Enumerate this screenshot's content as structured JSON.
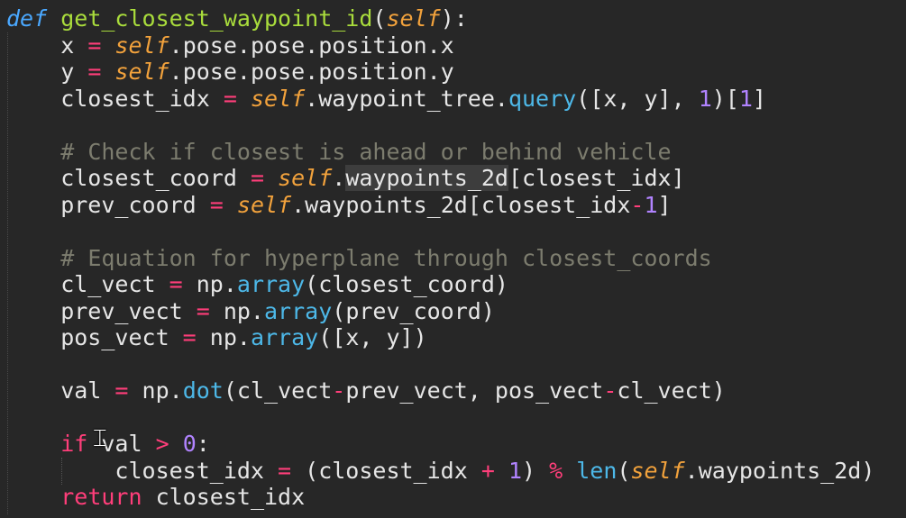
{
  "code_lines": [
    [
      {
        "t": "def",
        "c": "kw-def"
      },
      {
        "t": " "
      },
      {
        "t": "get_closest_waypoint_id",
        "c": "fn"
      },
      {
        "t": "("
      },
      {
        "t": "self",
        "c": "self"
      },
      {
        "t": "):"
      }
    ],
    [
      {
        "t": "    x "
      },
      {
        "t": "=",
        "c": "op"
      },
      {
        "t": " "
      },
      {
        "t": "self",
        "c": "self"
      },
      {
        "t": ".pose.pose.position.x"
      }
    ],
    [
      {
        "t": "    y "
      },
      {
        "t": "=",
        "c": "op"
      },
      {
        "t": " "
      },
      {
        "t": "self",
        "c": "self"
      },
      {
        "t": ".pose.pose.position.y"
      }
    ],
    [
      {
        "t": "    closest_idx "
      },
      {
        "t": "=",
        "c": "op"
      },
      {
        "t": " "
      },
      {
        "t": "self",
        "c": "self"
      },
      {
        "t": ".waypoint_tree."
      },
      {
        "t": "query",
        "c": "meth"
      },
      {
        "t": "([x, y], "
      },
      {
        "t": "1",
        "c": "num"
      },
      {
        "t": ")["
      },
      {
        "t": "1",
        "c": "num"
      },
      {
        "t": "]"
      }
    ],
    [
      {
        "t": ""
      }
    ],
    [
      {
        "t": "    "
      },
      {
        "t": "# Check if closest is ahead or behind vehicle",
        "c": "cmt"
      }
    ],
    [
      {
        "t": "    closest_coord "
      },
      {
        "t": "=",
        "c": "op"
      },
      {
        "t": " "
      },
      {
        "t": "self",
        "c": "self"
      },
      {
        "t": "."
      },
      {
        "t": "waypoints_2d",
        "c": "hl"
      },
      {
        "t": "[closest_idx]"
      }
    ],
    [
      {
        "t": "    prev_coord "
      },
      {
        "t": "=",
        "c": "op"
      },
      {
        "t": " "
      },
      {
        "t": "self",
        "c": "self"
      },
      {
        "t": ".waypoints_2d[closest_idx"
      },
      {
        "t": "-",
        "c": "op"
      },
      {
        "t": "1",
        "c": "num"
      },
      {
        "t": "]"
      }
    ],
    [
      {
        "t": ""
      }
    ],
    [
      {
        "t": "    "
      },
      {
        "t": "# Equation for hyperplane through closest_coords",
        "c": "cmt"
      }
    ],
    [
      {
        "t": "    cl_vect "
      },
      {
        "t": "=",
        "c": "op"
      },
      {
        "t": " np."
      },
      {
        "t": "array",
        "c": "meth"
      },
      {
        "t": "(closest_coord)"
      }
    ],
    [
      {
        "t": "    prev_vect "
      },
      {
        "t": "=",
        "c": "op"
      },
      {
        "t": " np."
      },
      {
        "t": "array",
        "c": "meth"
      },
      {
        "t": "(prev_coord)"
      }
    ],
    [
      {
        "t": "    pos_vect "
      },
      {
        "t": "=",
        "c": "op"
      },
      {
        "t": " np."
      },
      {
        "t": "array",
        "c": "meth"
      },
      {
        "t": "([x, y])"
      }
    ],
    [
      {
        "t": ""
      }
    ],
    [
      {
        "t": "    val "
      },
      {
        "t": "=",
        "c": "op"
      },
      {
        "t": " np."
      },
      {
        "t": "dot",
        "c": "meth"
      },
      {
        "t": "(cl_vect"
      },
      {
        "t": "-",
        "c": "op"
      },
      {
        "t": "prev_vect, pos_vect"
      },
      {
        "t": "-",
        "c": "op"
      },
      {
        "t": "cl_vect)"
      }
    ],
    [
      {
        "t": ""
      }
    ],
    [
      {
        "t": "    "
      },
      {
        "t": "if",
        "c": "kw"
      },
      {
        "t": " val "
      },
      {
        "t": ">",
        "c": "op"
      },
      {
        "t": " "
      },
      {
        "t": "0",
        "c": "num"
      },
      {
        "t": ":"
      }
    ],
    [
      {
        "t": "        closest_idx "
      },
      {
        "t": "=",
        "c": "op"
      },
      {
        "t": " (closest_idx "
      },
      {
        "t": "+",
        "c": "op"
      },
      {
        "t": " "
      },
      {
        "t": "1",
        "c": "num"
      },
      {
        "t": ") "
      },
      {
        "t": "%",
        "c": "op"
      },
      {
        "t": " "
      },
      {
        "t": "len",
        "c": "builtin"
      },
      {
        "t": "("
      },
      {
        "t": "self",
        "c": "self"
      },
      {
        "t": ".waypoints_2d)"
      }
    ],
    [
      {
        "t": "    "
      },
      {
        "t": "return",
        "c": "kw"
      },
      {
        "t": " closest_idx"
      }
    ]
  ],
  "colors": {
    "background": "#272727",
    "text": "#e6e6e6",
    "keyword_def": "#4aa8ff",
    "function_name": "#a9dc3c",
    "self": "#f2a23c",
    "operator": "#ff3e7a",
    "number": "#b183ff",
    "method": "#4db8e8",
    "comment": "#7c7c6e"
  },
  "cursor_icon": "text-cursor-icon"
}
